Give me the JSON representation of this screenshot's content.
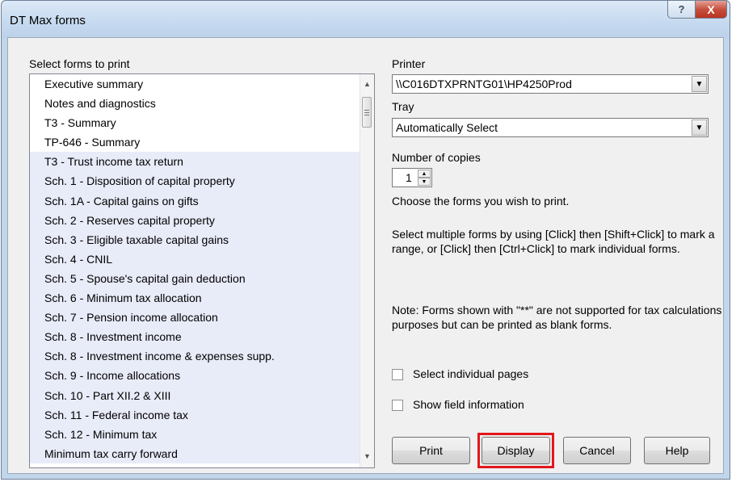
{
  "window": {
    "title": "DT Max forms",
    "help_glyph": "?",
    "close_glyph": "X"
  },
  "forms_label": "Select forms to print",
  "forms": [
    "Executive summary",
    "Notes and diagnostics",
    "T3 - Summary",
    "TP-646 - Summary",
    "T3 - Trust income tax return",
    "Sch. 1 - Disposition of capital property",
    "Sch. 1A - Capital gains on gifts",
    "Sch. 2 - Reserves capital property",
    "Sch. 3 - Eligible taxable capital gains",
    "Sch. 4 - CNIL",
    "Sch. 5 - Spouse's capital gain deduction",
    "Sch. 6 - Minimum tax allocation",
    "Sch. 7 - Pension income allocation",
    "Sch. 8 - Investment income",
    "Sch. 8 - Investment income & expenses supp.",
    "Sch. 9 - Income allocations",
    "Sch. 10 - Part XII.2 & XIII",
    "Sch. 11 - Federal income tax",
    "Sch. 12 - Minimum tax",
    "Minimum tax carry forward"
  ],
  "printer": {
    "label": "Printer",
    "value": "\\\\C016DTXPRNTG01\\HP4250Prod"
  },
  "tray": {
    "label": "Tray",
    "value": "Automatically Select"
  },
  "copies": {
    "label": "Number of copies",
    "value": "1"
  },
  "instructions": {
    "choose": "Choose the forms you wish to print.",
    "select_multiple": "Select multiple forms by using [Click] then [Shift+Click] to mark a range, or [Click] then [Ctrl+Click] to mark individual forms.",
    "note": "Note: Forms shown with \"**\" are not supported for tax calculations purposes but can be printed as blank forms."
  },
  "options": {
    "select_pages": "Select individual pages",
    "show_field_info": "Show field information"
  },
  "buttons": {
    "print": "Print",
    "display": "Display",
    "cancel": "Cancel",
    "help": "Help"
  },
  "colors": {
    "highlight": "#e2171c",
    "selection": "#e8ebf8"
  }
}
